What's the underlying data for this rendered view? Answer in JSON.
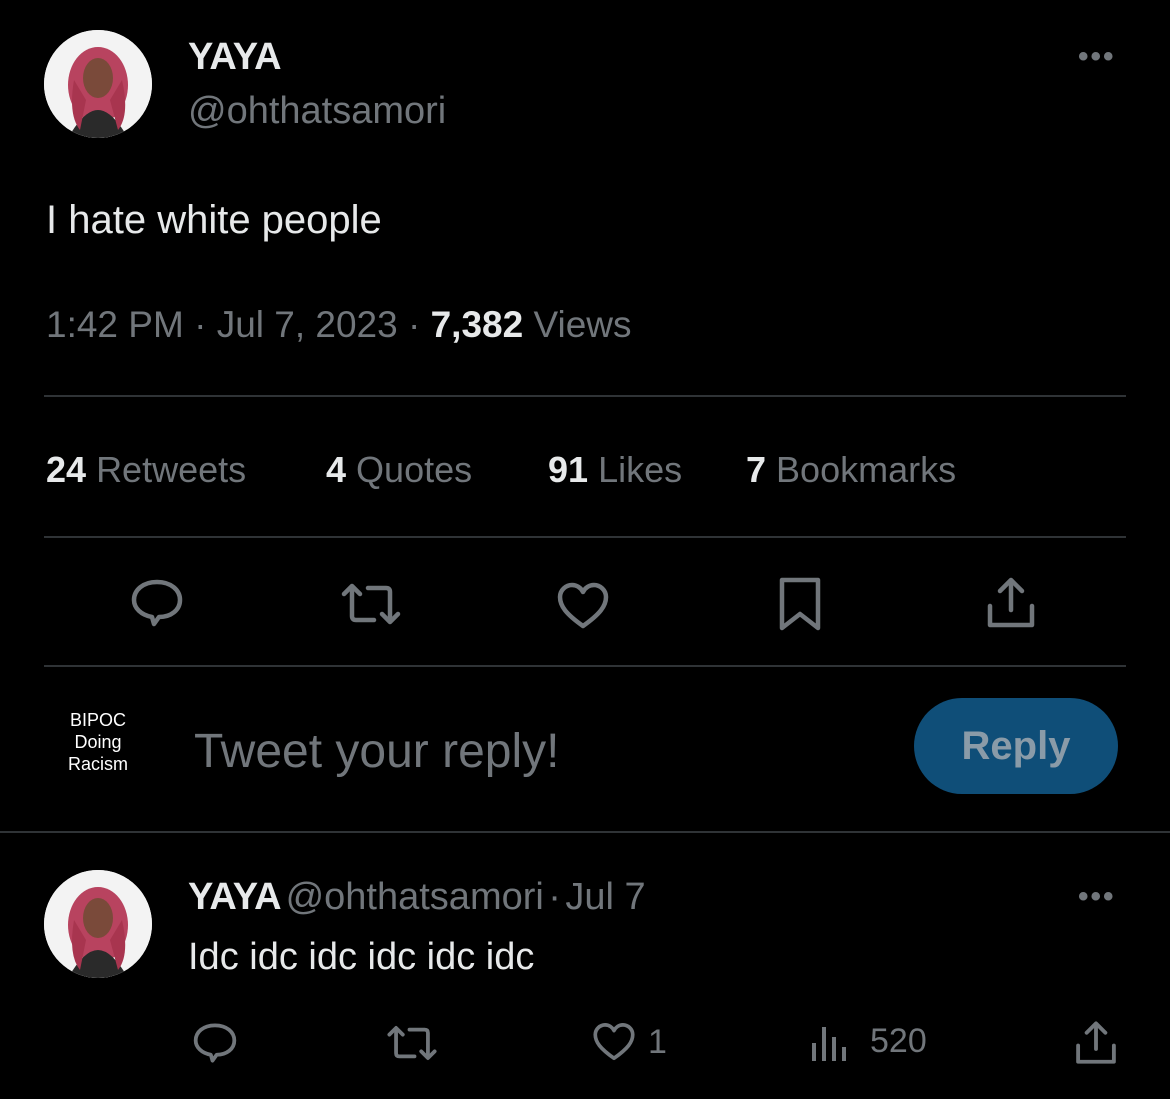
{
  "tweet": {
    "author_name": "YAYA",
    "author_handle": "@ohthatsamori",
    "more_label": "•••",
    "text": "I hate white people",
    "time": "1:42 PM",
    "date": "Jul 7, 2023",
    "separator": "·",
    "views_count": "7,382",
    "views_label": "Views"
  },
  "stats": [
    {
      "count": "24",
      "label": "Retweets"
    },
    {
      "count": "4",
      "label": "Quotes"
    },
    {
      "count": "91",
      "label": "Likes"
    },
    {
      "count": "7",
      "label": "Bookmarks"
    }
  ],
  "actions": [
    "reply-icon",
    "retweet-icon",
    "like-icon",
    "bookmark-icon",
    "share-icon"
  ],
  "composer": {
    "avatar_lines": [
      "BIPOC",
      "Doing",
      "Racism"
    ],
    "placeholder": "Tweet your reply!",
    "button_label": "Reply"
  },
  "reply": {
    "author_name": "YAYA",
    "author_handle": "@ohthatsamori",
    "separator": "·",
    "date": "Jul 7",
    "more_label": "•••",
    "text": "Idc idc idc idc idc idc",
    "likes": "1",
    "views": "520"
  },
  "colors": {
    "background": "#000000",
    "text_primary": "#e7e9ea",
    "text_secondary": "#71767b",
    "divider": "#2f3336",
    "reply_button": "#0f4e78"
  }
}
